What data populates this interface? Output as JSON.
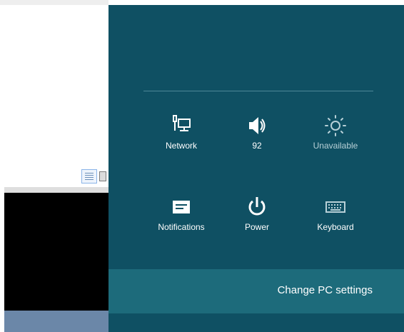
{
  "settings_panel": {
    "quick_settings": [
      {
        "key": "network",
        "label": "Network",
        "icon": "network-icon"
      },
      {
        "key": "volume",
        "label": "92",
        "icon": "speaker-icon"
      },
      {
        "key": "brightness",
        "label": "Unavailable",
        "icon": "brightness-icon"
      },
      {
        "key": "notifications",
        "label": "Notifications",
        "icon": "notifications-icon"
      },
      {
        "key": "power",
        "label": "Power",
        "icon": "power-icon"
      },
      {
        "key": "keyboard",
        "label": "Keyboard",
        "icon": "keyboard-icon"
      }
    ],
    "change_pc_settings": "Change PC settings"
  },
  "colors": {
    "panel_bg": "#0f5063",
    "bottom_bar_bg": "#1d6b7b",
    "text": "#ffffff"
  }
}
